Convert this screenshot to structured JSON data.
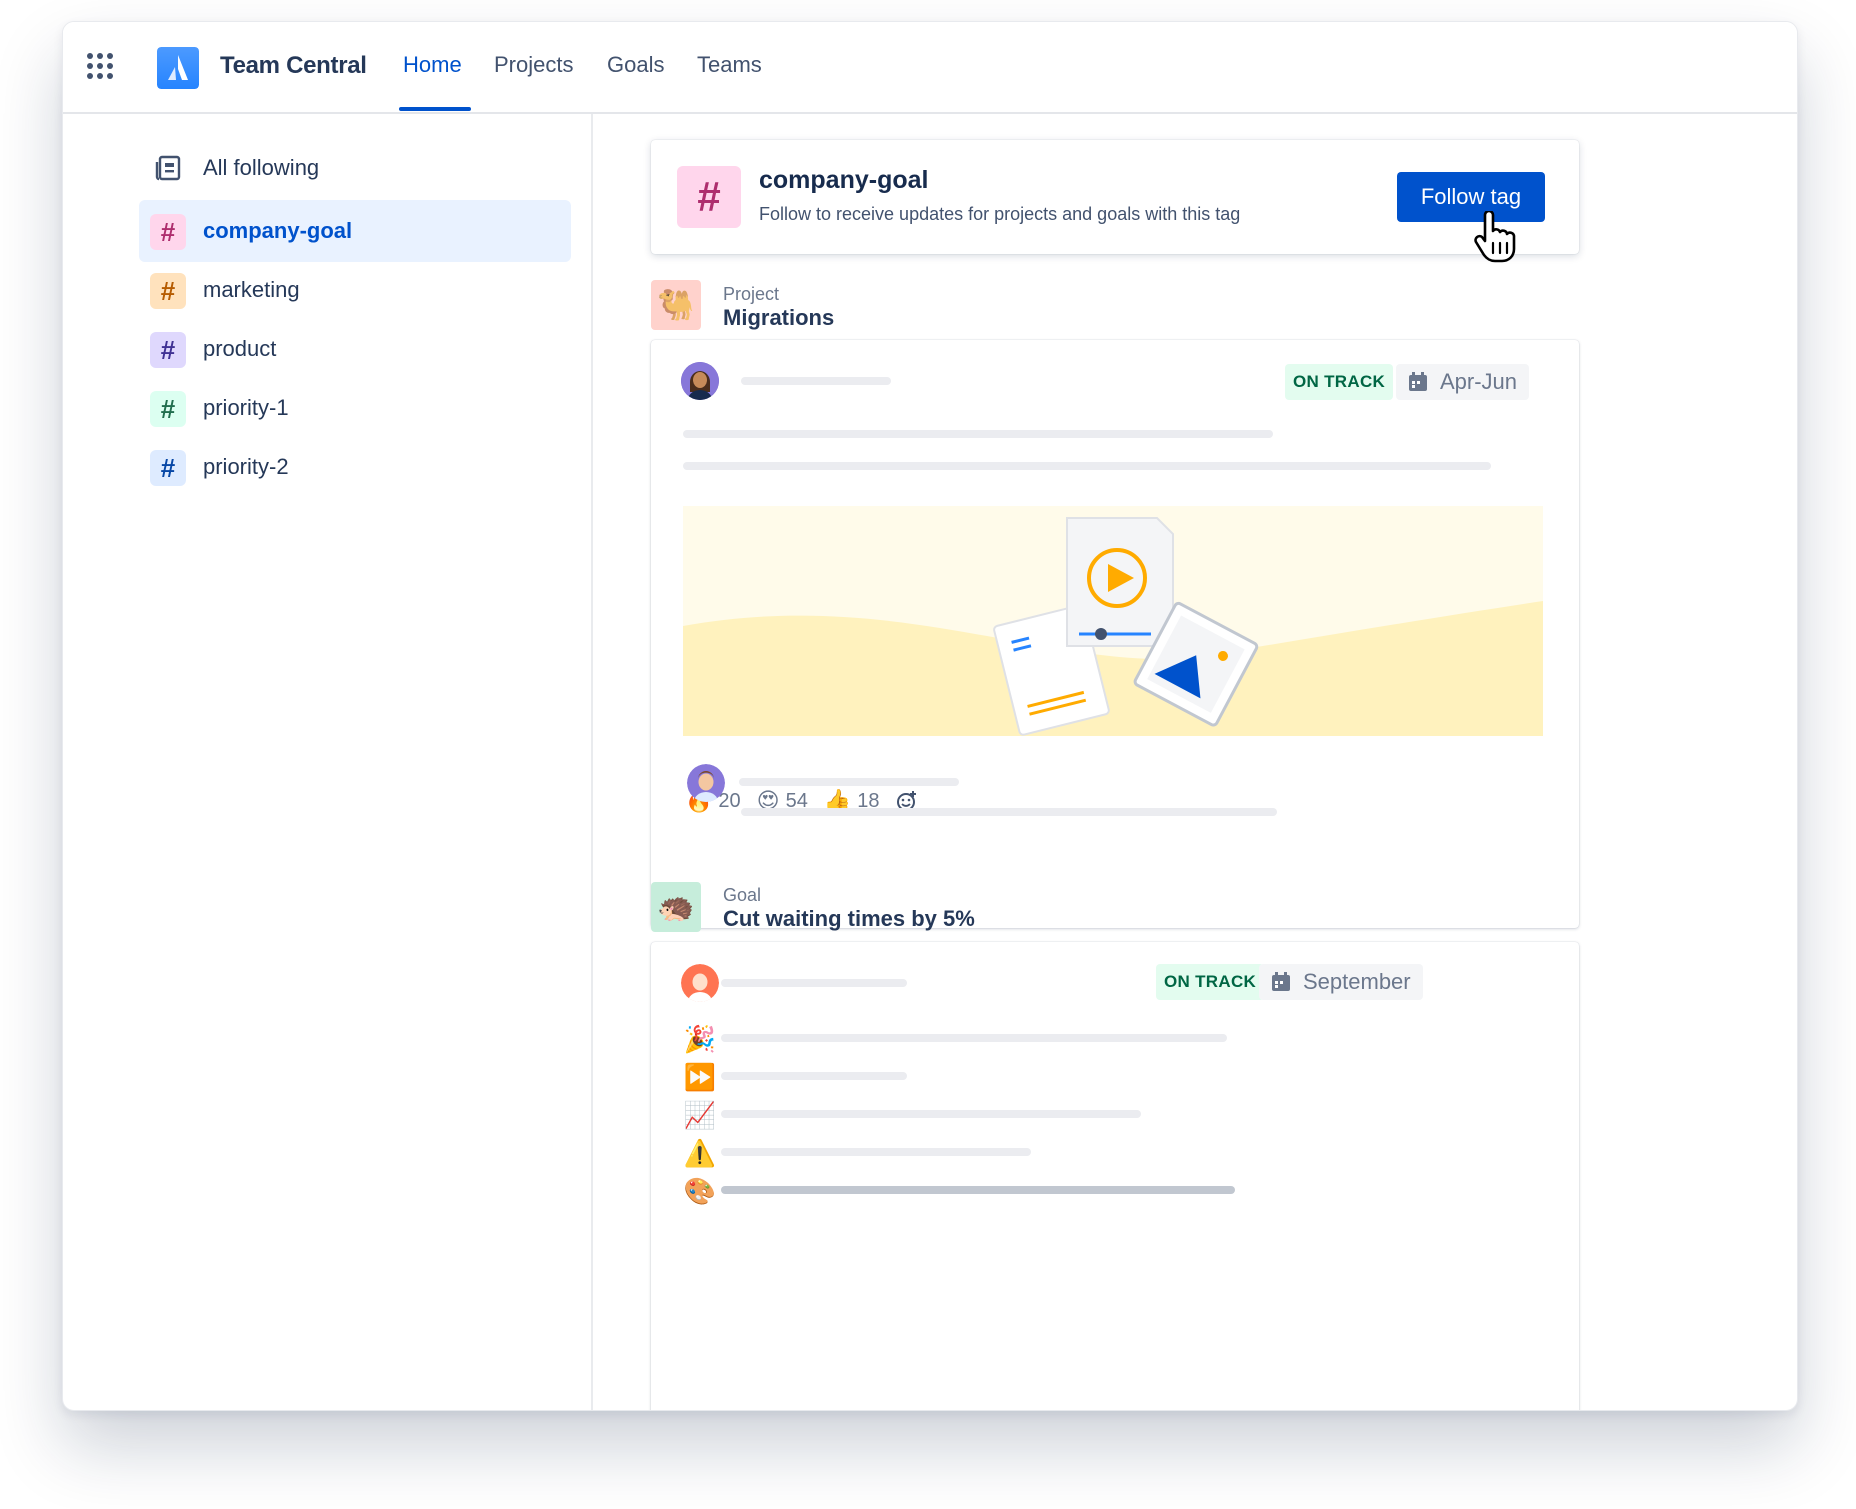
{
  "topnav": {
    "app_name": "Team Central",
    "tabs": [
      "Home",
      "Projects",
      "Goals",
      "Teams"
    ],
    "active_tab": "Home"
  },
  "sidebar": {
    "all_following": "All following",
    "tags": [
      {
        "label": "company-goal",
        "bg": "#FFD6EC",
        "fg": "#AE2E6E"
      },
      {
        "label": "marketing",
        "bg": "#FFE2BD",
        "fg": "#B65C02"
      },
      {
        "label": "product",
        "bg": "#DFD8FD",
        "fg": "#403294"
      },
      {
        "label": "priority-1",
        "bg": "#DCFFF1",
        "fg": "#216E4E"
      },
      {
        "label": "priority-2",
        "bg": "#DEEBFF",
        "fg": "#0747A6"
      }
    ],
    "active_tag": "company-goal"
  },
  "tag_card": {
    "symbol": "#",
    "title": "company-goal",
    "subtitle": "Follow to receive updates for projects and goals with this tag",
    "button": "Follow tag"
  },
  "project": {
    "kind": "Project",
    "title": "Migrations",
    "status": "ON TRACK",
    "date": "Apr-Jun",
    "reactions": [
      {
        "emoji": "🔥",
        "count": "20"
      },
      {
        "emoji": "😍",
        "count": "54"
      },
      {
        "emoji": "👍",
        "count": "18"
      }
    ]
  },
  "goal": {
    "kind": "Goal",
    "title": "Cut waiting times by 5%",
    "status": "ON TRACK",
    "date": "September",
    "update_emojis": [
      "🎉",
      "⏩",
      "📈",
      "⚠️",
      "🎨"
    ]
  },
  "colors": {
    "brand": "#0052CC",
    "success_bg": "#E3FCEF",
    "success_fg": "#006644"
  }
}
